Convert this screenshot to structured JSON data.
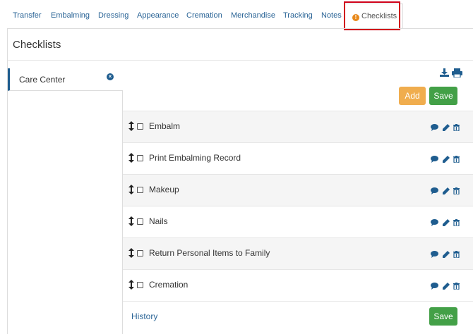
{
  "tabs": [
    {
      "label": "Transfer"
    },
    {
      "label": "Embalming"
    },
    {
      "label": "Dressing"
    },
    {
      "label": "Appearance"
    },
    {
      "label": "Cremation"
    },
    {
      "label": "Merchandise"
    },
    {
      "label": "Tracking"
    },
    {
      "label": "Notes"
    },
    {
      "label": "Checklists",
      "active": true,
      "icon": "warning-icon",
      "warning_glyph": "!"
    }
  ],
  "panel": {
    "title": "Checklists"
  },
  "sidebar": {
    "items": [
      {
        "label": "Care Center",
        "remove_icon": "close-icon",
        "remove_glyph": "×"
      }
    ]
  },
  "toolbar": {
    "download_icon": "download-icon",
    "print_icon": "print-icon",
    "add_label": "Add",
    "save_label": "Save"
  },
  "checklist": {
    "items": [
      {
        "label": "Embalm"
      },
      {
        "label": "Print Embalming Record"
      },
      {
        "label": "Makeup"
      },
      {
        "label": "Nails"
      },
      {
        "label": "Return Personal Items to Family"
      },
      {
        "label": "Cremation"
      }
    ],
    "row_icons": [
      "comment-icon",
      "edit-icon",
      "trash-icon"
    ]
  },
  "footer": {
    "history_label": "History",
    "save_label": "Save"
  },
  "colors": {
    "link": "#2a6496",
    "icon_blue": "#1f5d8f",
    "add_button": "#f0ad4e",
    "save_button": "#43a047",
    "highlight_border": "#d0021b",
    "warning": "#e8891b"
  }
}
